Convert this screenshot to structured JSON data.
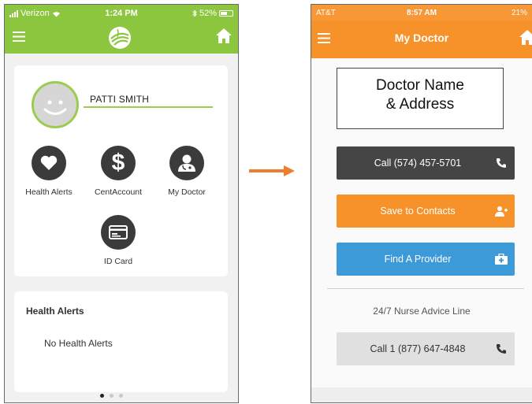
{
  "left_phone": {
    "status": {
      "carrier": "Verizon",
      "time": "1:24 PM",
      "battery": "52%"
    },
    "user_name": "PATTI SMITH",
    "tiles": [
      {
        "label": "Health Alerts",
        "icon": "heart-icon"
      },
      {
        "label": "CentAccount",
        "icon": "dollar-icon"
      },
      {
        "label": "My Doctor",
        "icon": "doctor-icon"
      },
      {
        "label": "ID Card",
        "icon": "id-card-icon"
      }
    ],
    "alerts": {
      "title": "Health Alerts",
      "empty_text": "No Health Alerts"
    },
    "pager": {
      "count": 3,
      "active": 0
    }
  },
  "right_phone": {
    "status": {
      "carrier": "AT&T",
      "time": "8:57 AM",
      "battery": "21%"
    },
    "title": "My Doctor",
    "doctor_box": {
      "line1": "Doctor Name",
      "line2": "& Address"
    },
    "call_button": "Call (574) 457-5701",
    "save_button": "Save to Contacts",
    "find_button": "Find A Provider",
    "nurse_label": "24/7 Nurse Advice Line",
    "nurse_call_button": "Call 1 (877) 647-4848"
  },
  "colors": {
    "green": "#8cc63f",
    "orange": "#f7922b",
    "dark": "#454545",
    "blue": "#3c9ad9",
    "arrow": "#ed7d31"
  }
}
